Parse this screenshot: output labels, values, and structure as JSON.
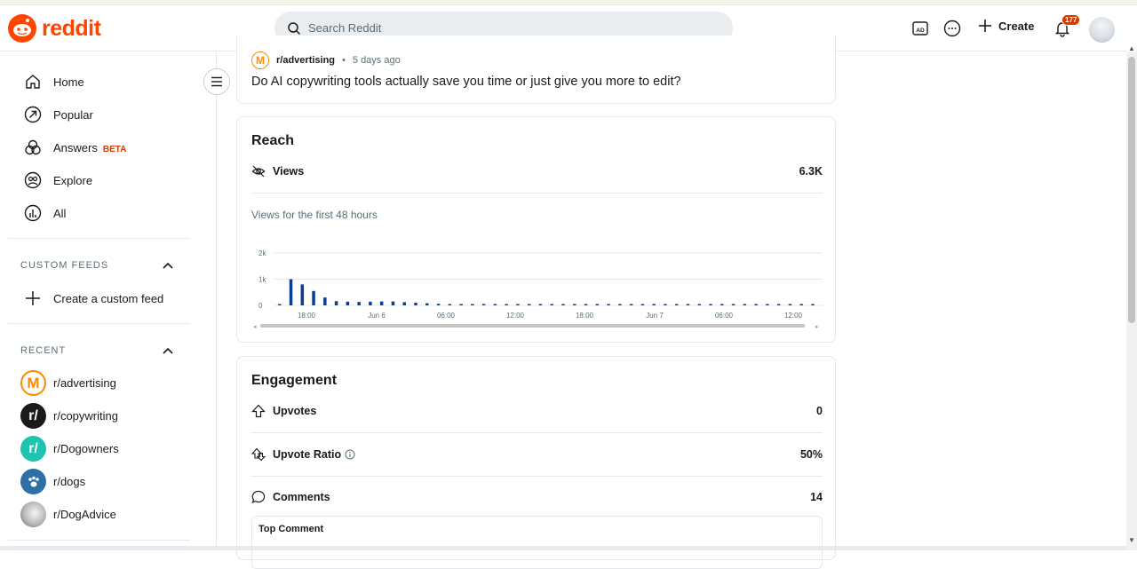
{
  "header": {
    "logo_text": "reddit",
    "search_placeholder": "Search Reddit",
    "create_label": "Create",
    "notification_count": "177",
    "brand_color": "#ff4500"
  },
  "sidebar": {
    "nav": [
      {
        "label": "Home",
        "icon": "home-icon"
      },
      {
        "label": "Popular",
        "icon": "popular-icon"
      },
      {
        "label": "Answers",
        "icon": "answers-icon",
        "badge": "BETA"
      },
      {
        "label": "Explore",
        "icon": "explore-icon"
      },
      {
        "label": "All",
        "icon": "all-icon"
      }
    ],
    "custom_feeds_title": "CUSTOM FEEDS",
    "create_feed_label": "Create a custom feed",
    "recent_title": "RECENT",
    "recent": [
      {
        "label": "r/advertising",
        "color": "#ff8a00"
      },
      {
        "label": "r/copywriting",
        "color": "#1a1a1b"
      },
      {
        "label": "r/Dogowners",
        "color": "#1ec3b1"
      },
      {
        "label": "r/dogs",
        "color": "#2e6fa8"
      },
      {
        "label": "r/DogAdvice",
        "color": "#8a8a8a"
      }
    ]
  },
  "post": {
    "subreddit": "r/advertising",
    "age": "5 days ago",
    "title": "Do AI copywriting tools actually save you time or just give you more to edit?"
  },
  "reach": {
    "title": "Reach",
    "views_label": "Views",
    "views_value": "6.3K",
    "chart_caption": "Views for the first 48 hours"
  },
  "chart_data": {
    "type": "bar",
    "title": "",
    "ylim": [
      0,
      2000
    ],
    "y_ticks": [
      "2k",
      "1k",
      "0"
    ],
    "x_tick_labels": [
      "18:00",
      "Jun 6",
      "06:00",
      "12:00",
      "18:00",
      "Jun 7",
      "06:00",
      "12:00"
    ],
    "values": [
      30,
      1000,
      800,
      550,
      300,
      160,
      140,
      130,
      140,
      150,
      150,
      120,
      100,
      80,
      60,
      50,
      40,
      40,
      40,
      30,
      30,
      30,
      30,
      20,
      20,
      20,
      20,
      20,
      20,
      20,
      20,
      20,
      20,
      20,
      20,
      20,
      20,
      20,
      20,
      20,
      20,
      20,
      20,
      20,
      20,
      20,
      20,
      20
    ],
    "bar_color": "#0b3d91"
  },
  "engagement": {
    "title": "Engagement",
    "upvotes_label": "Upvotes",
    "upvotes_value": "0",
    "ratio_label": "Upvote Ratio",
    "ratio_value": "50%",
    "comments_label": "Comments",
    "comments_value": "14",
    "top_comment_label": "Top Comment"
  }
}
